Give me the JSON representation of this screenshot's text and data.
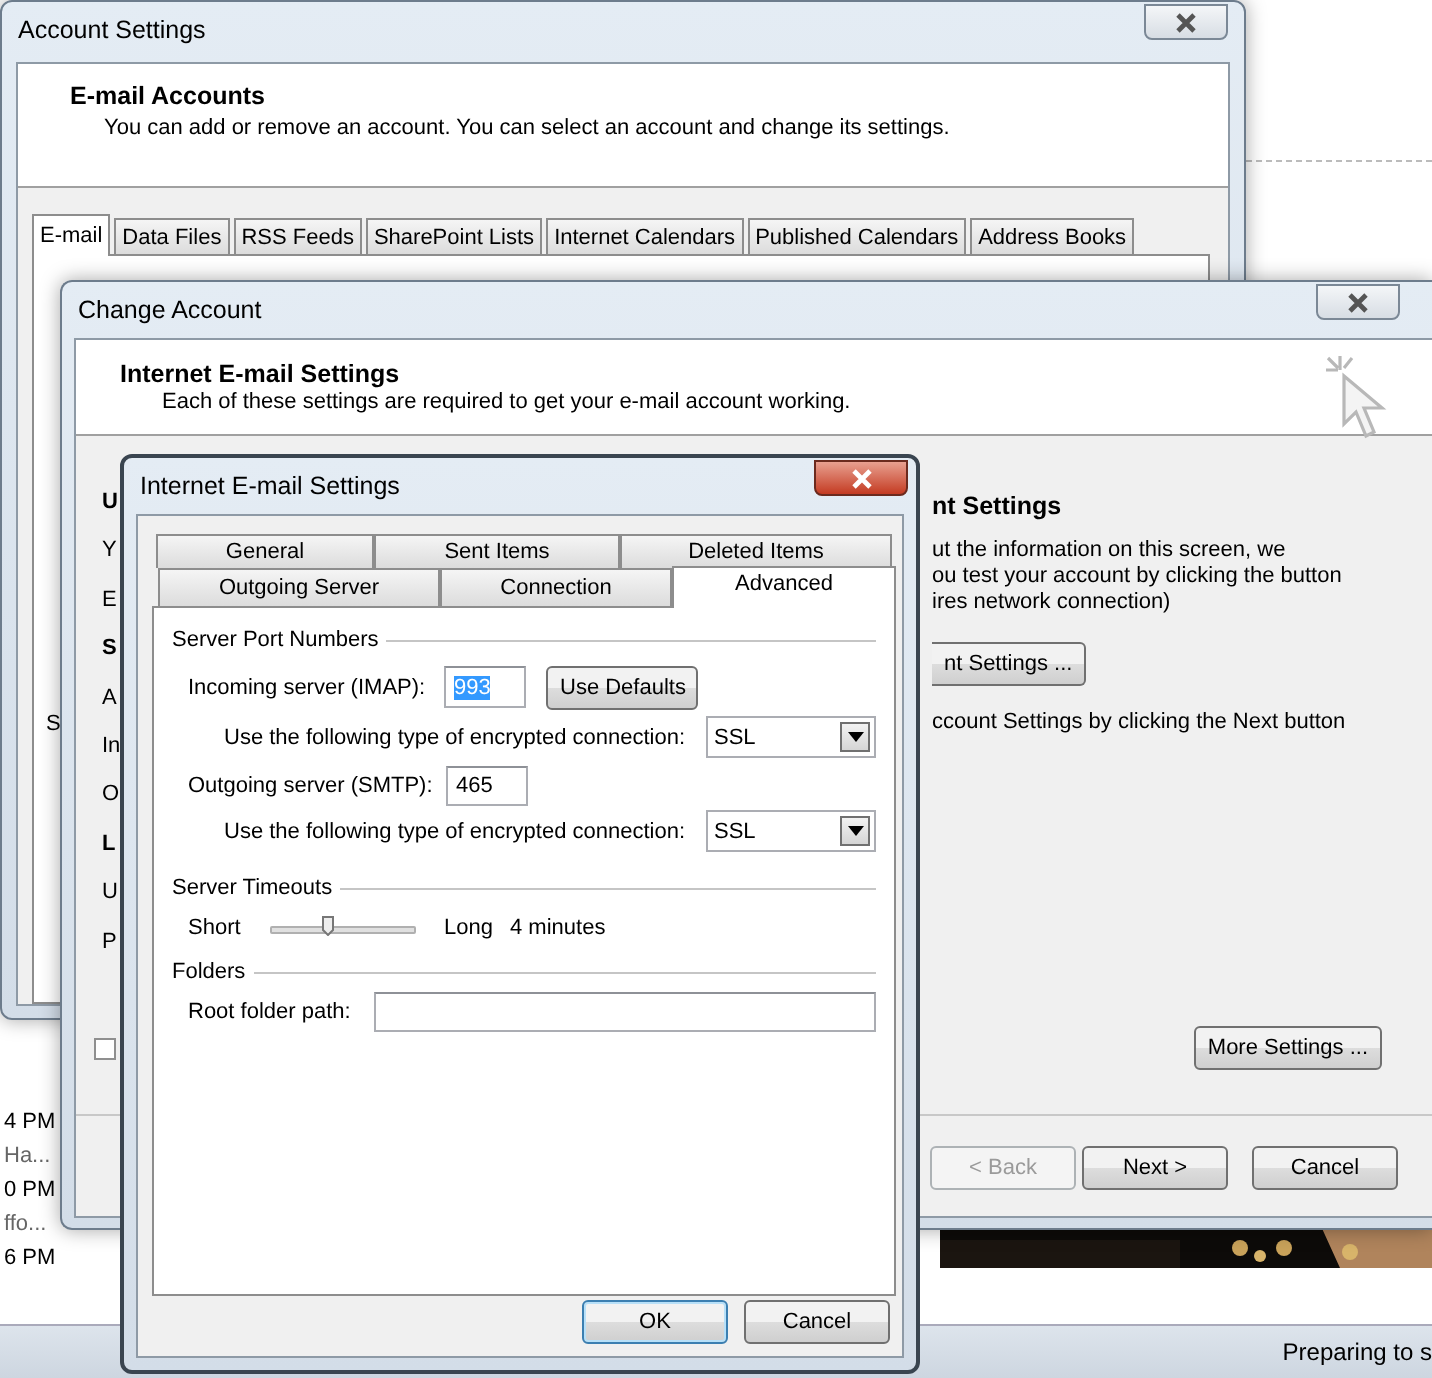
{
  "account_settings": {
    "title": "Account Settings",
    "heading": "E-mail Accounts",
    "description": "You can add or remove an account. You can select an account and change its settings.",
    "tabs": [
      {
        "label": "E-mail",
        "selected": true
      },
      {
        "label": "Data Files",
        "selected": false
      },
      {
        "label": "RSS Feeds",
        "selected": false
      },
      {
        "label": "SharePoint Lists",
        "selected": false
      },
      {
        "label": "Internet Calendars",
        "selected": false
      },
      {
        "label": "Published Calendars",
        "selected": false
      },
      {
        "label": "Address Books",
        "selected": false
      }
    ],
    "fragment": "S"
  },
  "change_account": {
    "title": "Change Account",
    "heading": "Internet E-mail Settings",
    "description": "Each of these settings are required to get your e-mail account working.",
    "left_fragments": [
      {
        "text": "U",
        "kind": "heading"
      },
      {
        "text": "Y",
        "kind": "text"
      },
      {
        "text": "E",
        "kind": "text"
      },
      {
        "text": "S",
        "kind": "heading"
      },
      {
        "text": "A",
        "kind": "text"
      },
      {
        "text": "In",
        "kind": "text"
      },
      {
        "text": "O",
        "kind": "text"
      },
      {
        "text": "L",
        "kind": "heading"
      },
      {
        "text": "U",
        "kind": "text"
      },
      {
        "text": "P",
        "kind": "text"
      }
    ],
    "checkbox": {
      "checked": false
    },
    "test_heading": "nt Settings",
    "test_lines": [
      "ut the information on this screen, we",
      "ou test your account by clicking the button",
      "ires network connection)"
    ],
    "test_button": "nt Settings ...",
    "next_note": "ccount Settings by clicking the Next button",
    "more_settings_button": "More Settings ...",
    "buttons": [
      {
        "label": "< Back",
        "disabled": true
      },
      {
        "label": "Next >",
        "disabled": false
      },
      {
        "label": "Cancel",
        "disabled": false
      }
    ]
  },
  "internet_email_settings": {
    "title": "Internet E-mail Settings",
    "tab_rows": [
      [
        {
          "label": "General",
          "selected": false
        },
        {
          "label": "Sent Items",
          "selected": false
        },
        {
          "label": "Deleted Items",
          "selected": false
        }
      ],
      [
        {
          "label": "Outgoing Server",
          "selected": false
        },
        {
          "label": "Connection",
          "selected": false
        },
        {
          "label": "Advanced",
          "selected": true
        }
      ]
    ],
    "server_port_numbers": {
      "legend": "Server Port Numbers",
      "incoming_label": "Incoming server (IMAP):",
      "incoming_value": "993",
      "use_defaults_button": "Use Defaults",
      "incoming_encryption_label": "Use the following type of encrypted connection:",
      "incoming_encryption": "SSL",
      "outgoing_label": "Outgoing server (SMTP):",
      "outgoing_value": "465",
      "outgoing_encryption_label": "Use the following type of encrypted connection:",
      "outgoing_encryption": "SSL"
    },
    "server_timeouts": {
      "legend": "Server Timeouts",
      "short_label": "Short",
      "level": 0.4,
      "long_label": "Long",
      "reading": "4 minutes"
    },
    "folders": {
      "legend": "Folders",
      "root_folder_label": "Root folder path:"
    },
    "buttons": [
      "OK",
      "Cancel"
    ]
  },
  "background": {
    "list_fragments": [
      "4 PM",
      "Ha...",
      "0 PM",
      "ffo...",
      "6 PM"
    ],
    "status_text": "Preparing to s"
  }
}
